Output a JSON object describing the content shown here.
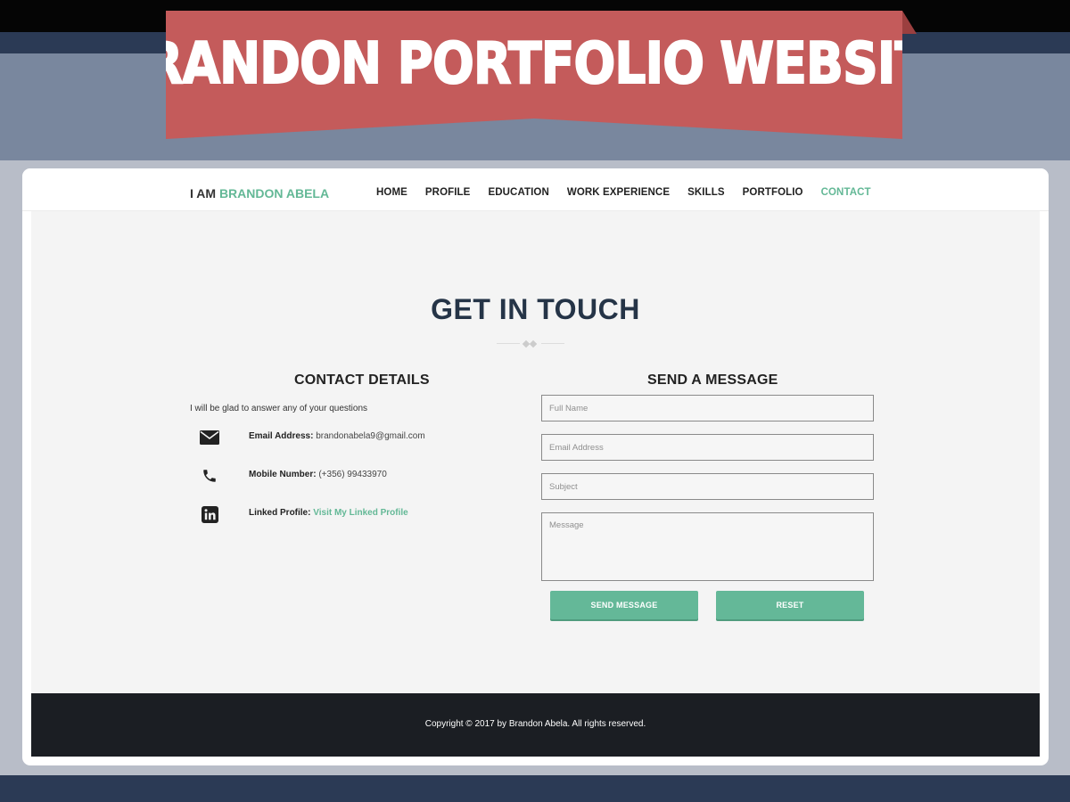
{
  "banner": {
    "title": "BRANDON PORTFOLIO WEBSITE"
  },
  "navbar": {
    "brand_prefix": "I AM",
    "brand_name": "BRANDON ABELA",
    "items": [
      {
        "label": "HOME",
        "active": false
      },
      {
        "label": "PROFILE",
        "active": false
      },
      {
        "label": "EDUCATION",
        "active": false
      },
      {
        "label": "WORK EXPERIENCE",
        "active": false
      },
      {
        "label": "SKILLS",
        "active": false
      },
      {
        "label": "PORTFOLIO",
        "active": false
      },
      {
        "label": "CONTACT",
        "active": true
      }
    ]
  },
  "main": {
    "title": "GET IN TOUCH",
    "contact_details": {
      "heading": "CONTACT DETAILS",
      "intro": "I will be glad to answer any of your questions",
      "items": [
        {
          "icon": "envelope-icon",
          "label": "Email Address:",
          "value": "brandonabela9@gmail.com"
        },
        {
          "icon": "phone-icon",
          "label": "Mobile Number:",
          "value": "(+356) 99433970"
        },
        {
          "icon": "linkedin-icon",
          "label": "Linked Profile:",
          "link_text": "Visit My Linked Profile"
        }
      ]
    },
    "send_message": {
      "heading": "SEND A MESSAGE",
      "fields": {
        "full_name": {
          "placeholder": "Full Name",
          "value": ""
        },
        "email": {
          "placeholder": "Email Address",
          "value": ""
        },
        "subject": {
          "placeholder": "Subject",
          "value": ""
        },
        "message": {
          "placeholder": "Message",
          "value": ""
        }
      },
      "send_label": "SEND MESSAGE",
      "reset_label": "RESET"
    }
  },
  "footer": {
    "copyright": "Copyright © 2017 by Brandon Abela. All rights reserved."
  },
  "colors": {
    "accent": "#63b896",
    "banner": "#c45b5b",
    "navy": "#2b3a55",
    "footer": "#1b1e23",
    "heading": "#253447"
  }
}
